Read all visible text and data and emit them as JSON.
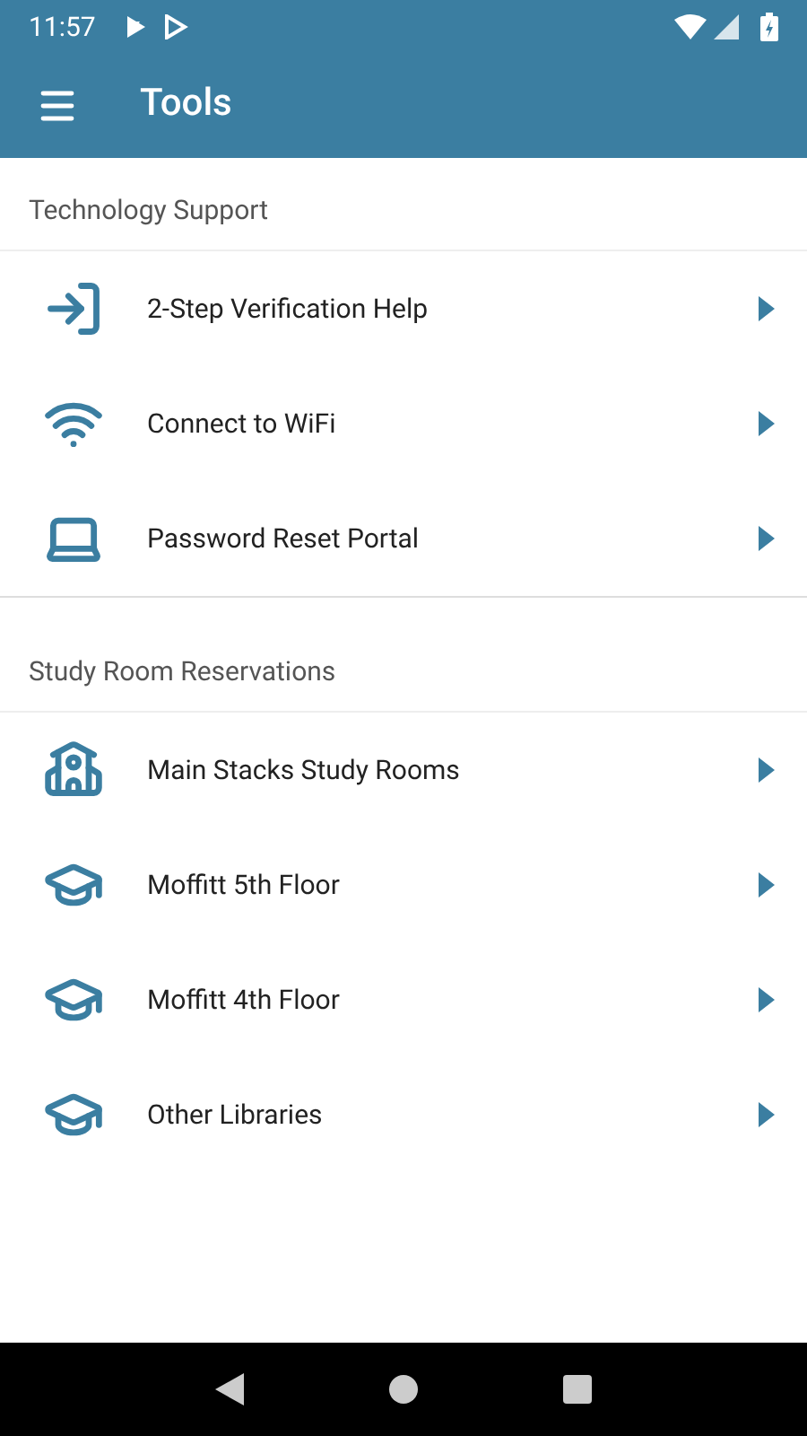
{
  "status_bar": {
    "time": "11:57"
  },
  "app_bar": {
    "title": "Tools"
  },
  "sections": [
    {
      "title": "Technology Support",
      "items": [
        {
          "label": "2-Step Verification Help",
          "kind": "signin"
        },
        {
          "label": "Connect to WiFi",
          "kind": "wifi"
        },
        {
          "label": "Password Reset Portal",
          "kind": "laptop"
        }
      ]
    },
    {
      "title": "Study Room Reservations",
      "items": [
        {
          "label": "Main Stacks Study Rooms",
          "kind": "school"
        },
        {
          "label": "Moffitt 5th Floor",
          "kind": "cap"
        },
        {
          "label": "Moffitt 4th Floor",
          "kind": "cap"
        },
        {
          "label": "Other Libraries",
          "kind": "cap"
        }
      ]
    }
  ]
}
